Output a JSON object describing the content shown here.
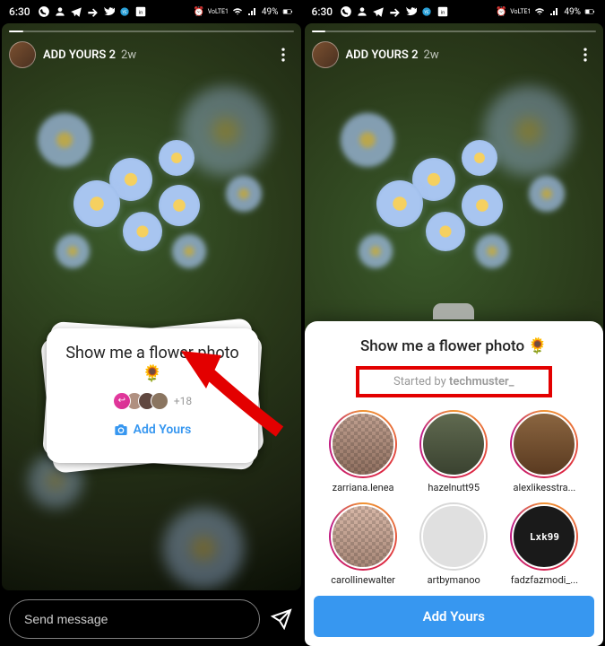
{
  "status": {
    "time": "6:30",
    "battery": "49%",
    "network": "VoLTE1"
  },
  "story": {
    "title": "ADD YOURS 2",
    "time": "2w"
  },
  "sticker": {
    "prompt": "Show me a flower photo 🌻",
    "more_count": "+18",
    "add_button": "Add Yours"
  },
  "footer": {
    "placeholder": "Send message"
  },
  "sheet": {
    "title": "Show me a flower photo 🌻",
    "started_prefix": "Started by ",
    "started_user": "techmuster_",
    "users": [
      {
        "name": "zarriana.lenea"
      },
      {
        "name": "hazelnutt95"
      },
      {
        "name": "alexlikesstra..."
      },
      {
        "name": "carollinewalter"
      },
      {
        "name": "artbymanoo"
      },
      {
        "name": "fadzfazmodi_..."
      }
    ],
    "button": "Add Yours"
  }
}
